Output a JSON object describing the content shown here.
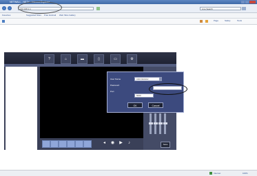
{
  "browser": {
    "window_title": "NETWALL - NETY... Internet Explorer",
    "url": "192.168.1.1",
    "search_placeholder": "Live Search",
    "favorites": [
      "Favorites",
      "Suggested Sites",
      "Free Hotmail",
      "Web Slice Gallery"
    ],
    "commands": [
      "Page",
      "Safety",
      "Tools"
    ]
  },
  "app": {
    "nav": [
      {
        "name": "help",
        "glyph": "?"
      },
      {
        "name": "home",
        "glyph": "⌂"
      },
      {
        "name": "video",
        "glyph": "▬"
      },
      {
        "name": "playback",
        "glyph": "▯"
      },
      {
        "name": "monitor",
        "glyph": "▭"
      },
      {
        "name": "settings",
        "glyph": "⚙"
      }
    ],
    "save_label": "Save",
    "login": {
      "username_label": "User Name",
      "username_value": "Administrator",
      "password_label": "Password",
      "port_label": "Port",
      "port_value": "5000",
      "ok_label": "OK",
      "cancel_label": "Cancel"
    }
  },
  "status": {
    "zone": "Internet",
    "zoom": "100%"
  }
}
